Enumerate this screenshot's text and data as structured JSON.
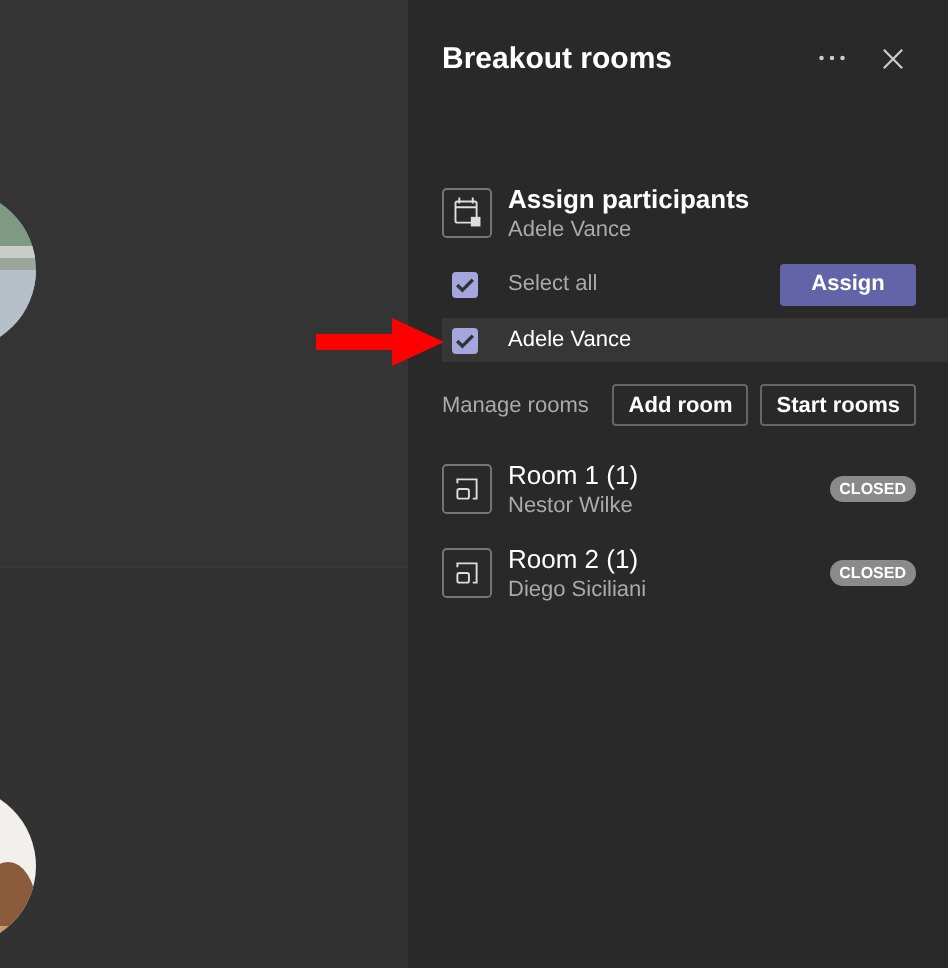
{
  "panel": {
    "title": "Breakout rooms"
  },
  "assign": {
    "title": "Assign participants",
    "subtitle": "Adele Vance",
    "button": "Assign"
  },
  "select_all": {
    "label": "Select all",
    "checked": true
  },
  "participants": [
    {
      "name": "Adele Vance",
      "checked": true,
      "selected": true
    }
  ],
  "manage": {
    "label": "Manage rooms",
    "buttons": [
      "Add room",
      "Start rooms"
    ]
  },
  "rooms": [
    {
      "name": "Room 1 (1)",
      "member": "Nestor Wilke",
      "status": "CLOSED"
    },
    {
      "name": "Room 2 (1)",
      "member": "Diego Siciliani",
      "status": "CLOSED"
    }
  ]
}
